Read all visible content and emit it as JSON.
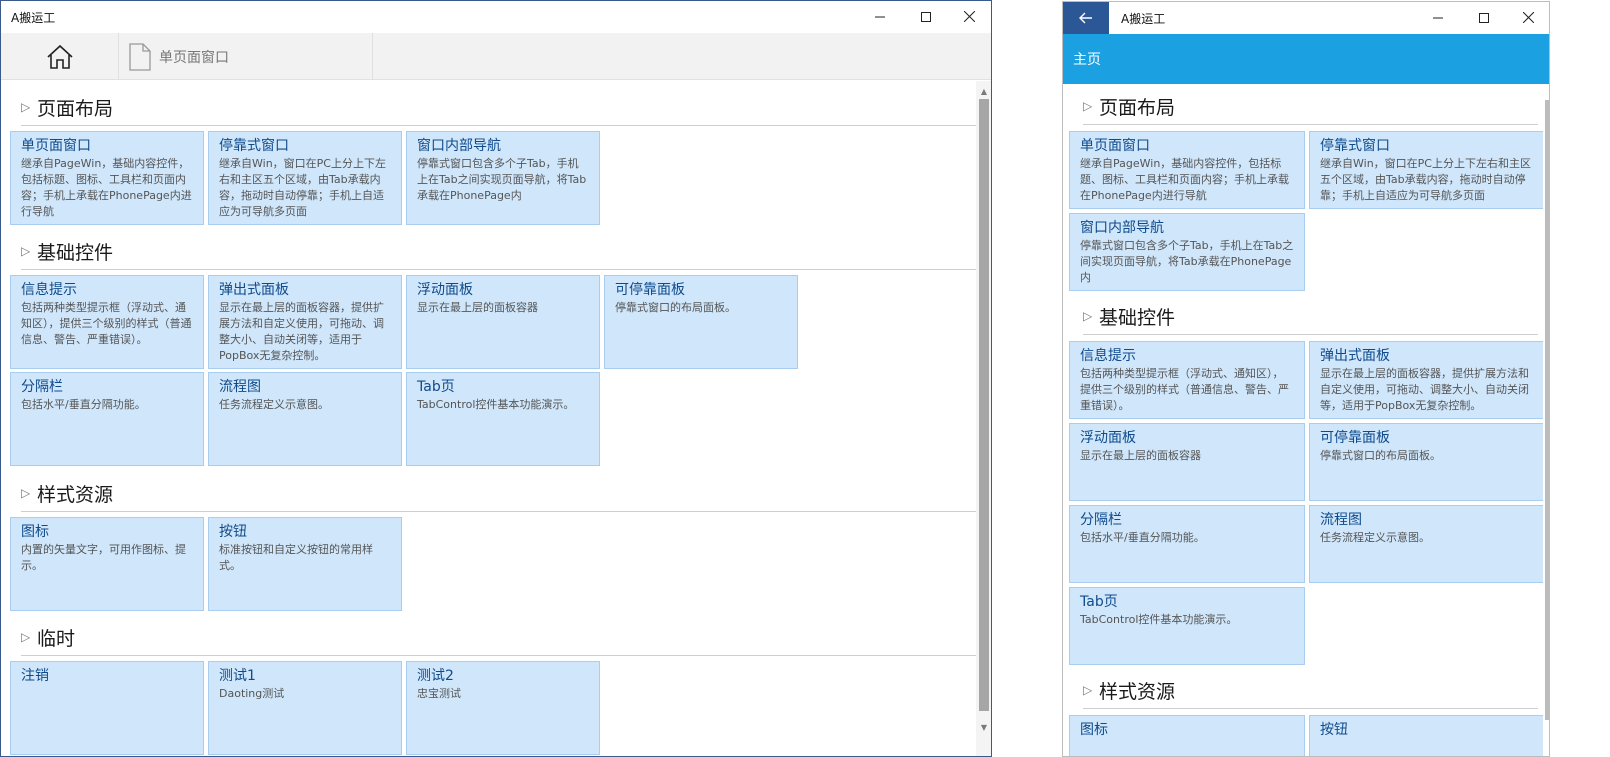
{
  "app": {
    "title": "A搬运工"
  },
  "window_desktop": {
    "tabs": {
      "doc_tab_label": "单页面窗口"
    },
    "sections": [
      {
        "title": "页面布局",
        "tiles": [
          {
            "title": "单页面窗口",
            "desc": "继承自PageWin，基础内容控件，包括标题、图标、工具栏和页面内容；手机上承载在PhonePage内进行导航"
          },
          {
            "title": "停靠式窗口",
            "desc": "继承自Win，窗口在PC上分上下左右和主区五个区域，由Tab承载内容，拖动时自动停靠；手机上自适应为可导航多页面"
          },
          {
            "title": "窗口内部导航",
            "desc": "停靠式窗口包含多个子Tab，手机上在Tab之间实现页面导航，将Tab承载在PhonePage内"
          }
        ]
      },
      {
        "title": "基础控件",
        "tiles": [
          {
            "title": "信息提示",
            "desc": "包括两种类型提示框（浮动式、通知区），提供三个级别的样式（普通信息、警告、严重错误）。"
          },
          {
            "title": "弹出式面板",
            "desc": "显示在最上层的面板容器，提供扩展方法和自定义使用，可拖动、调整大小、自动关闭等，适用于PopBox无复杂控制。"
          },
          {
            "title": "浮动面板",
            "desc": "显示在最上层的面板容器"
          },
          {
            "title": "可停靠面板",
            "desc": "停靠式窗口的布局面板。"
          },
          {
            "title": "分隔栏",
            "desc": "包括水平/垂直分隔功能。"
          },
          {
            "title": "流程图",
            "desc": "任务流程定义示意图。"
          },
          {
            "title": "Tab页",
            "desc": "TabControl控件基本功能演示。"
          }
        ]
      },
      {
        "title": "样式资源",
        "tiles": [
          {
            "title": "图标",
            "desc": "内置的矢量文字，可用作图标、提示。"
          },
          {
            "title": "按钮",
            "desc": "标准按钮和自定义按钮的常用样式。"
          }
        ]
      },
      {
        "title": "临时",
        "tiles": [
          {
            "title": "注销",
            "desc": ""
          },
          {
            "title": "测试1",
            "desc": "Daoting测试"
          },
          {
            "title": "测试2",
            "desc": "忠宝测试"
          }
        ]
      }
    ]
  },
  "window_phone": {
    "header_title": "主页",
    "sections": [
      {
        "title": "页面布局",
        "tiles": [
          {
            "title": "单页面窗口",
            "desc": "继承自PageWin，基础内容控件，包括标题、图标、工具栏和页面内容；手机上承载在PhonePage内进行导航"
          },
          {
            "title": "停靠式窗口",
            "desc": "继承自Win，窗口在PC上分上下左右和主区五个区域，由Tab承载内容，拖动时自动停靠；手机上自适应为可导航多页面"
          },
          {
            "title": "窗口内部导航",
            "desc": "停靠式窗口包含多个子Tab，手机上在Tab之间实现页面导航，将Tab承载在PhonePage内"
          }
        ]
      },
      {
        "title": "基础控件",
        "tiles": [
          {
            "title": "信息提示",
            "desc": "包括两种类型提示框（浮动式、通知区），提供三个级别的样式（普通信息、警告、严重错误）。"
          },
          {
            "title": "弹出式面板",
            "desc": "显示在最上层的面板容器，提供扩展方法和自定义使用，可拖动、调整大小、自动关闭等，适用于PopBox无复杂控制。"
          },
          {
            "title": "浮动面板",
            "desc": "显示在最上层的面板容器"
          },
          {
            "title": "可停靠面板",
            "desc": "停靠式窗口的布局面板。"
          },
          {
            "title": "分隔栏",
            "desc": "包括水平/垂直分隔功能。"
          },
          {
            "title": "流程图",
            "desc": "任务流程定义示意图。"
          },
          {
            "title": "Tab页",
            "desc": "TabControl控件基本功能演示。"
          }
        ]
      },
      {
        "title": "样式资源",
        "tiles": [
          {
            "title": "图标",
            "desc": ""
          },
          {
            "title": "按钮",
            "desc": ""
          }
        ]
      }
    ]
  },
  "icons": {
    "minimize": "minimize-icon",
    "maximize": "maximize-icon",
    "close": "close-icon",
    "home": "home-icon",
    "document": "document-icon",
    "back": "back-arrow-icon",
    "section_toggle": "triangle-right-icon"
  },
  "colors": {
    "tile_bg": "#cfe6fb",
    "tile_border": "#a9cdf0",
    "tile_title": "#0f4b8c",
    "phone_header": "#1ba1e2",
    "back_button": "#2b5797"
  }
}
